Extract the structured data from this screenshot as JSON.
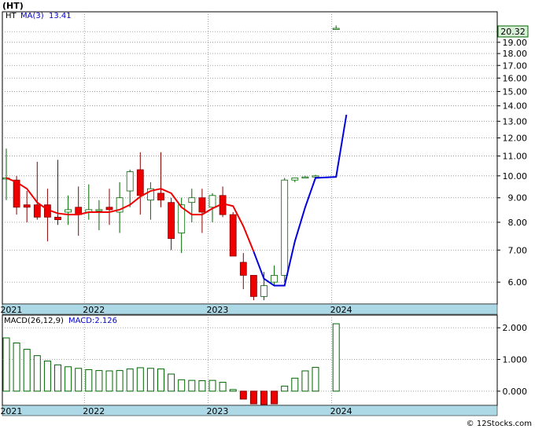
{
  "header": {
    "ticker": "(HT)"
  },
  "price_legend": {
    "symbol": "HT",
    "ma_label": "MA(3)",
    "ma_value": "13.41"
  },
  "macd_legend": {
    "params": "MACD(26,12,9)",
    "label": "MACD:2.126"
  },
  "last_price": "20.32",
  "watermark": "© 12Stocks.com",
  "colors": {
    "up": "#ffffff",
    "up_border": "#006600",
    "down": "#ee0000",
    "down_border": "#880000",
    "ma_red": "#ee0000",
    "ma_blue": "#0000dd",
    "macd_bar": "#006600",
    "axis_band": "#add8e6",
    "grid": "#888888",
    "price_box": "#d8f0d8"
  },
  "chart_data": [
    {
      "type": "candlestick",
      "scale": "log",
      "ylim": [
        5.4,
        22
      ],
      "yticks": [
        "6.00",
        "7.00",
        "8.00",
        "9.00",
        "10.00",
        "11.00",
        "12.00",
        "13.00",
        "14.00",
        "15.00",
        "16.00",
        "17.00",
        "18.00",
        "19.00",
        "20.00"
      ],
      "xticks": [
        {
          "label": "2021",
          "index": 0
        },
        {
          "label": "2022",
          "index": 8
        },
        {
          "label": "2023",
          "index": 20
        },
        {
          "label": "2024",
          "index": 32
        }
      ],
      "candles": [
        {
          "o": 9.9,
          "h": 11.4,
          "l": 8.9,
          "c": 9.9
        },
        {
          "o": 9.8,
          "h": 10.0,
          "l": 8.3,
          "c": 8.6
        },
        {
          "o": 8.7,
          "h": 9.3,
          "l": 8.0,
          "c": 8.6
        },
        {
          "o": 8.7,
          "h": 10.7,
          "l": 8.1,
          "c": 8.2
        },
        {
          "o": 8.7,
          "h": 9.4,
          "l": 7.3,
          "c": 8.2
        },
        {
          "o": 8.2,
          "h": 10.8,
          "l": 7.9,
          "c": 8.1
        },
        {
          "o": 8.4,
          "h": 9.1,
          "l": 7.9,
          "c": 8.5
        },
        {
          "o": 8.6,
          "h": 9.5,
          "l": 7.5,
          "c": 8.3
        },
        {
          "o": 8.4,
          "h": 9.6,
          "l": 8.1,
          "c": 8.5
        },
        {
          "o": 8.5,
          "h": 8.9,
          "l": 7.7,
          "c": 8.5
        },
        {
          "o": 8.6,
          "h": 9.4,
          "l": 7.9,
          "c": 8.5
        },
        {
          "o": 8.4,
          "h": 9.7,
          "l": 7.6,
          "c": 9.0
        },
        {
          "o": 9.3,
          "h": 10.3,
          "l": 8.6,
          "c": 10.2
        },
        {
          "o": 10.3,
          "h": 11.2,
          "l": 8.3,
          "c": 9.1
        },
        {
          "o": 8.9,
          "h": 9.7,
          "l": 8.1,
          "c": 9.4
        },
        {
          "o": 9.2,
          "h": 11.2,
          "l": 8.6,
          "c": 8.9
        },
        {
          "o": 8.8,
          "h": 9.0,
          "l": 7.0,
          "c": 7.4
        },
        {
          "o": 7.6,
          "h": 9.0,
          "l": 6.9,
          "c": 8.7
        },
        {
          "o": 8.8,
          "h": 9.4,
          "l": 8.0,
          "c": 9.0
        },
        {
          "o": 9.0,
          "h": 9.4,
          "l": 7.6,
          "c": 8.4
        },
        {
          "o": 8.6,
          "h": 9.2,
          "l": 8.0,
          "c": 9.1
        },
        {
          "o": 9.1,
          "h": 9.5,
          "l": 8.2,
          "c": 8.3
        },
        {
          "o": 8.3,
          "h": 8.4,
          "l": 6.8,
          "c": 6.8
        },
        {
          "o": 6.6,
          "h": 6.9,
          "l": 5.8,
          "c": 6.2
        },
        {
          "o": 6.2,
          "h": 6.2,
          "l": 5.5,
          "c": 5.6
        },
        {
          "o": 5.6,
          "h": 6.3,
          "l": 5.5,
          "c": 5.9
        },
        {
          "o": 6.0,
          "h": 6.5,
          "l": 5.9,
          "c": 6.2
        },
        {
          "o": 6.2,
          "h": 9.9,
          "l": 6.0,
          "c": 9.8
        },
        {
          "o": 9.8,
          "h": 9.9,
          "l": 9.7,
          "c": 9.9
        },
        {
          "o": 9.95,
          "h": 10.0,
          "l": 9.9,
          "c": 9.95
        },
        {
          "o": 10.0,
          "h": 10.05,
          "l": 9.95,
          "c": 10.0
        },
        null,
        {
          "o": 20.3,
          "h": 20.6,
          "l": 20.2,
          "c": 20.32
        }
      ],
      "ma3": [
        9.9,
        9.7,
        9.4,
        8.8,
        8.5,
        8.35,
        8.3,
        8.3,
        8.4,
        8.4,
        8.4,
        8.5,
        8.7,
        9.05,
        9.3,
        9.4,
        9.2,
        8.6,
        8.3,
        8.3,
        8.55,
        8.75,
        8.65,
        7.85,
        6.95,
        6.1,
        5.9,
        5.9,
        7.3,
        8.6,
        9.9,
        9.95,
        13.41
      ],
      "ma_color_split_index": 24
    },
    {
      "type": "bar",
      "title": "MACD(26,12,9)",
      "ylim": [
        -0.45,
        2.4
      ],
      "yticks": [
        "0.000",
        "1.000",
        "2.000"
      ],
      "values": [
        1.68,
        1.52,
        1.32,
        1.12,
        0.95,
        0.83,
        0.77,
        0.72,
        0.68,
        0.65,
        0.64,
        0.65,
        0.7,
        0.74,
        0.72,
        0.7,
        0.54,
        0.36,
        0.34,
        0.33,
        0.34,
        0.28,
        0.05,
        -0.25,
        -0.4,
        -0.42,
        -0.4,
        0.16,
        0.41,
        0.64,
        0.75,
        null,
        2.126
      ]
    }
  ]
}
